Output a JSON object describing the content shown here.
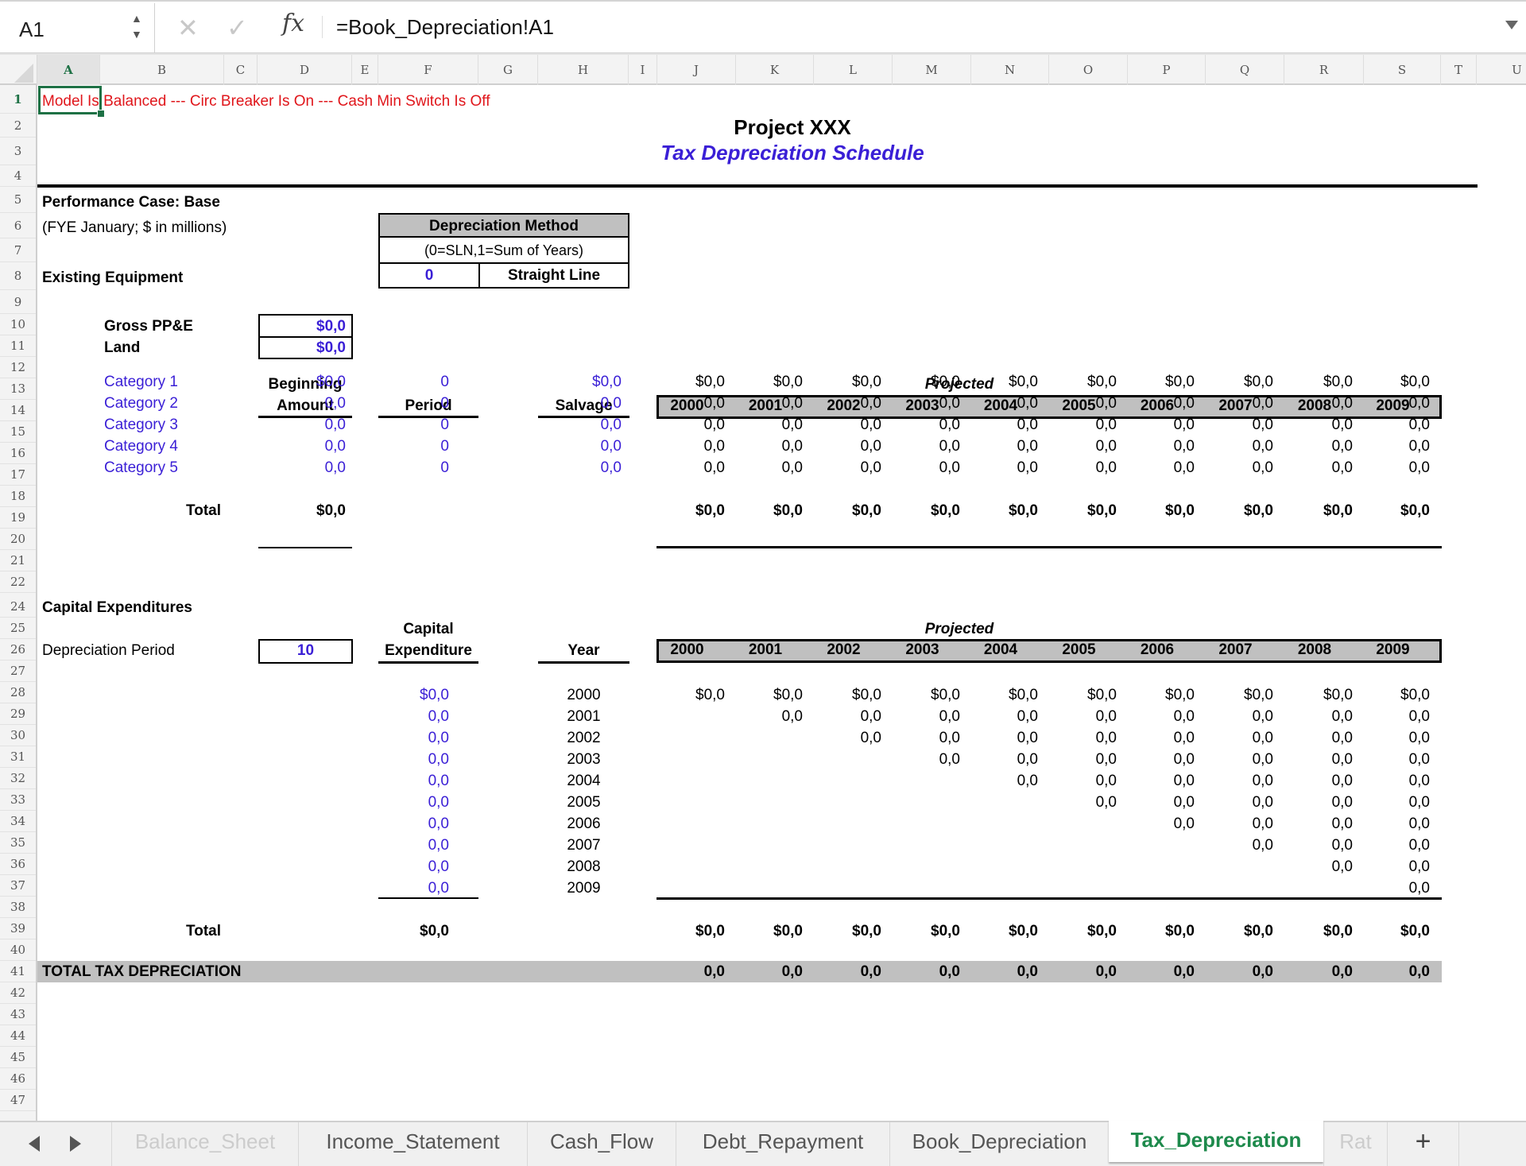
{
  "formula_bar": {
    "name_box": "A1",
    "cancel_icon": "✕",
    "confirm_icon": "✓",
    "fx_label": "fx",
    "formula": "=Book_Depreciation!A1"
  },
  "columns": [
    "A",
    "B",
    "C",
    "D",
    "E",
    "F",
    "G",
    "H",
    "I",
    "J",
    "K",
    "L",
    "M",
    "N",
    "O",
    "P",
    "Q",
    "R",
    "S",
    "T",
    "U"
  ],
  "selected_column": "A",
  "rows": [
    "1",
    "2",
    "3",
    "4",
    "5",
    "6",
    "7",
    "8",
    "9",
    "10",
    "11",
    "12",
    "13",
    "14",
    "15",
    "16",
    "17",
    "18",
    "19",
    "20",
    "21",
    "22",
    "24",
    "25",
    "26",
    "27",
    "28",
    "29",
    "30",
    "31",
    "32",
    "33",
    "34",
    "35",
    "36",
    "37",
    "38",
    "39",
    "40",
    "41",
    "42",
    "43",
    "44",
    "45",
    "46",
    "47"
  ],
  "sheet": {
    "status_line": "Model Is Balanced --- Circ Breaker Is On --- Cash Min Switch Is Off",
    "title": "Project XXX",
    "subtitle": "Tax Depreciation Schedule",
    "performance_case": "Performance Case: Base",
    "fye_note": "(FYE January; $ in millions)",
    "existing_equipment": "Existing Equipment",
    "dep_method": {
      "header": "Depreciation Method",
      "legend": "(0=SLN,1=Sum of Years)",
      "value": "0",
      "label": "Straight Line"
    },
    "gross_ppe_label": "Gross PP&E",
    "gross_ppe_value": "$0,0",
    "land_label": "Land",
    "land_value": "$0,0",
    "existing_headers": {
      "beginning_1": "Beginning",
      "beginning_2": "Amount",
      "period": "Period",
      "salvage": "Salvage",
      "projected": "Projected"
    },
    "years": [
      "2000",
      "2001",
      "2002",
      "2003",
      "2004",
      "2005",
      "2006",
      "2007",
      "2008",
      "2009"
    ],
    "categories": [
      {
        "name": "Category 1",
        "beginning": "$0,0",
        "period": "0",
        "salvage": "$0,0",
        "values": [
          "$0,0",
          "$0,0",
          "$0,0",
          "$0,0",
          "$0,0",
          "$0,0",
          "$0,0",
          "$0,0",
          "$0,0",
          "$0,0"
        ]
      },
      {
        "name": "Category 2",
        "beginning": "0,0",
        "period": "0",
        "salvage": "0,0",
        "values": [
          "0,0",
          "0,0",
          "0,0",
          "0,0",
          "0,0",
          "0,0",
          "0,0",
          "0,0",
          "0,0",
          "0,0"
        ]
      },
      {
        "name": "Category 3",
        "beginning": "0,0",
        "period": "0",
        "salvage": "0,0",
        "values": [
          "0,0",
          "0,0",
          "0,0",
          "0,0",
          "0,0",
          "0,0",
          "0,0",
          "0,0",
          "0,0",
          "0,0"
        ]
      },
      {
        "name": "Category 4",
        "beginning": "0,0",
        "period": "0",
        "salvage": "0,0",
        "values": [
          "0,0",
          "0,0",
          "0,0",
          "0,0",
          "0,0",
          "0,0",
          "0,0",
          "0,0",
          "0,0",
          "0,0"
        ]
      },
      {
        "name": "Category 5",
        "beginning": "0,0",
        "period": "0",
        "salvage": "0,0",
        "values": [
          "0,0",
          "0,0",
          "0,0",
          "0,0",
          "0,0",
          "0,0",
          "0,0",
          "0,0",
          "0,0",
          "0,0"
        ]
      }
    ],
    "existing_total": {
      "label": "Total",
      "beginning": "$0,0",
      "values": [
        "$0,0",
        "$0,0",
        "$0,0",
        "$0,0",
        "$0,0",
        "$0,0",
        "$0,0",
        "$0,0",
        "$0,0",
        "$0,0"
      ]
    },
    "capex": {
      "section_label": "Capital Expenditures",
      "dep_period_label": "Depreciation Period",
      "dep_period_value": "10",
      "capex_header_1": "Capital",
      "capex_header_2": "Expenditure",
      "year_header": "Year",
      "projected": "Projected",
      "rows": [
        {
          "amount": "$0,0",
          "year": "2000",
          "values": [
            "$0,0",
            "$0,0",
            "$0,0",
            "$0,0",
            "$0,0",
            "$0,0",
            "$0,0",
            "$0,0",
            "$0,0",
            "$0,0"
          ]
        },
        {
          "amount": "0,0",
          "year": "2001",
          "values": [
            "",
            "0,0",
            "0,0",
            "0,0",
            "0,0",
            "0,0",
            "0,0",
            "0,0",
            "0,0",
            "0,0"
          ]
        },
        {
          "amount": "0,0",
          "year": "2002",
          "values": [
            "",
            "",
            "0,0",
            "0,0",
            "0,0",
            "0,0",
            "0,0",
            "0,0",
            "0,0",
            "0,0"
          ]
        },
        {
          "amount": "0,0",
          "year": "2003",
          "values": [
            "",
            "",
            "",
            "0,0",
            "0,0",
            "0,0",
            "0,0",
            "0,0",
            "0,0",
            "0,0"
          ]
        },
        {
          "amount": "0,0",
          "year": "2004",
          "values": [
            "",
            "",
            "",
            "",
            "0,0",
            "0,0",
            "0,0",
            "0,0",
            "0,0",
            "0,0"
          ]
        },
        {
          "amount": "0,0",
          "year": "2005",
          "values": [
            "",
            "",
            "",
            "",
            "",
            "0,0",
            "0,0",
            "0,0",
            "0,0",
            "0,0"
          ]
        },
        {
          "amount": "0,0",
          "year": "2006",
          "values": [
            "",
            "",
            "",
            "",
            "",
            "",
            "0,0",
            "0,0",
            "0,0",
            "0,0"
          ]
        },
        {
          "amount": "0,0",
          "year": "2007",
          "values": [
            "",
            "",
            "",
            "",
            "",
            "",
            "",
            "0,0",
            "0,0",
            "0,0"
          ]
        },
        {
          "amount": "0,0",
          "year": "2008",
          "values": [
            "",
            "",
            "",
            "",
            "",
            "",
            "",
            "",
            "0,0",
            "0,0"
          ]
        },
        {
          "amount": "0,0",
          "year": "2009",
          "values": [
            "",
            "",
            "",
            "",
            "",
            "",
            "",
            "",
            "",
            "0,0"
          ]
        }
      ],
      "total": {
        "label": "Total",
        "amount": "$0,0",
        "values": [
          "$0,0",
          "$0,0",
          "$0,0",
          "$0,0",
          "$0,0",
          "$0,0",
          "$0,0",
          "$0,0",
          "$0,0",
          "$0,0"
        ]
      }
    },
    "total_tax_depreciation": {
      "label": "TOTAL TAX DEPRECIATION",
      "values": [
        "0,0",
        "0,0",
        "0,0",
        "0,0",
        "0,0",
        "0,0",
        "0,0",
        "0,0",
        "0,0",
        "0,0"
      ]
    }
  },
  "tabs": {
    "items": [
      "Balance_Sheet",
      "Income_Statement",
      "Cash_Flow",
      "Debt_Repayment",
      "Book_Depreciation",
      "Tax_Depreciation",
      "Rat"
    ],
    "active": "Tax_Depreciation",
    "add_label": "+"
  },
  "colors": {
    "selection": "#1e7145",
    "input_blue": "#3a1fd6",
    "alert_red": "#e0161b",
    "header_grey": "#c0c0c0"
  }
}
